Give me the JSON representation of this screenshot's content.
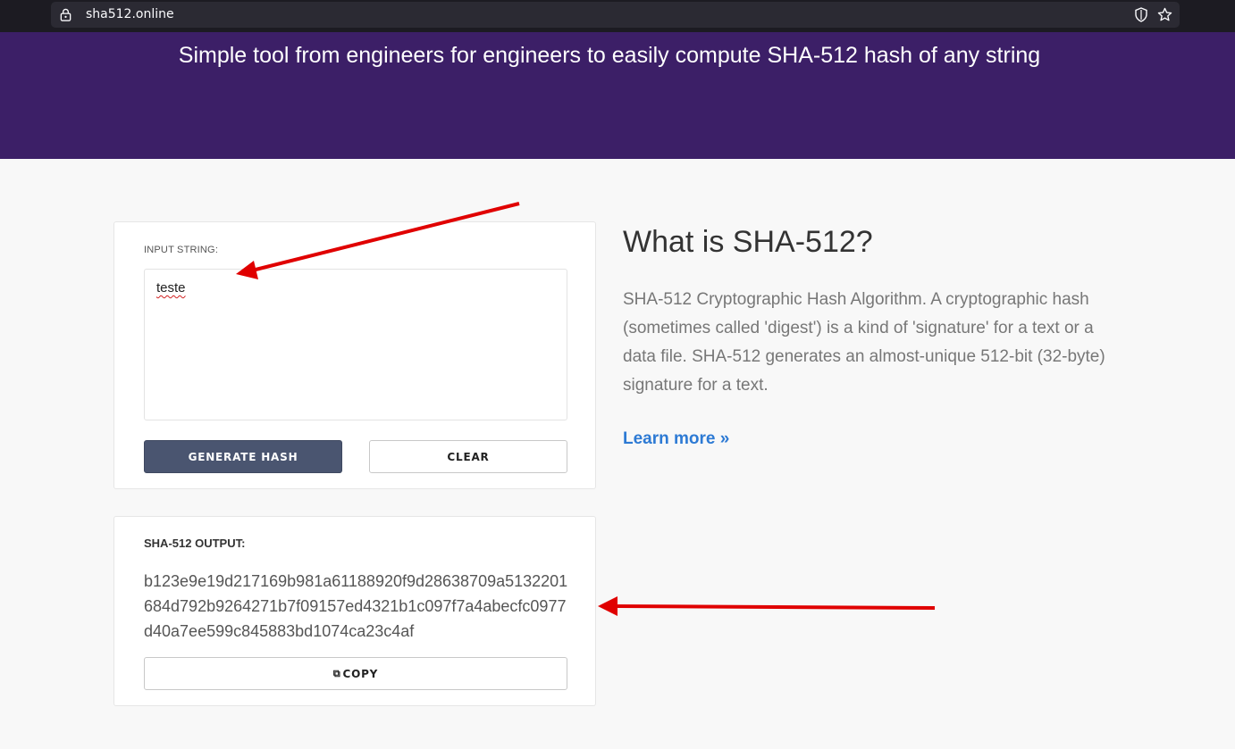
{
  "browser": {
    "url": "sha512.online",
    "icons": [
      "lock-icon",
      "shield-icon",
      "star-icon"
    ]
  },
  "hero": {
    "tagline": "Simple tool from engineers for engineers to easily compute SHA-512 hash of any string"
  },
  "input_card": {
    "label": "INPUT STRING:",
    "value": "teste",
    "generate_label": "GENERATE HASH",
    "clear_label": "CLEAR"
  },
  "output_card": {
    "label": "SHA-512 OUTPUT:",
    "hash": "b123e9e19d217169b981a61188920f9d28638709a5132201684d792b9264271b7f09157ed4321b1c097f7a4abecfc0977d40a7ee599c845883bd1074ca23c4af",
    "copy_label": "COPY",
    "copy_icon": "copy-icon"
  },
  "info": {
    "title": "What is SHA-512?",
    "body": "SHA-512 Cryptographic Hash Algorithm. A cryptographic hash (sometimes called 'digest') is a kind of 'signature' for a text or a data file. SHA-512 generates an almost-unique 512-bit (32-byte) signature for a text.",
    "learn_more": "Learn more »"
  },
  "colors": {
    "hero_bg": "#3c1f67",
    "primary_button": "#4a5570",
    "link": "#2d7ad4",
    "annotation_arrow": "#e00000"
  }
}
